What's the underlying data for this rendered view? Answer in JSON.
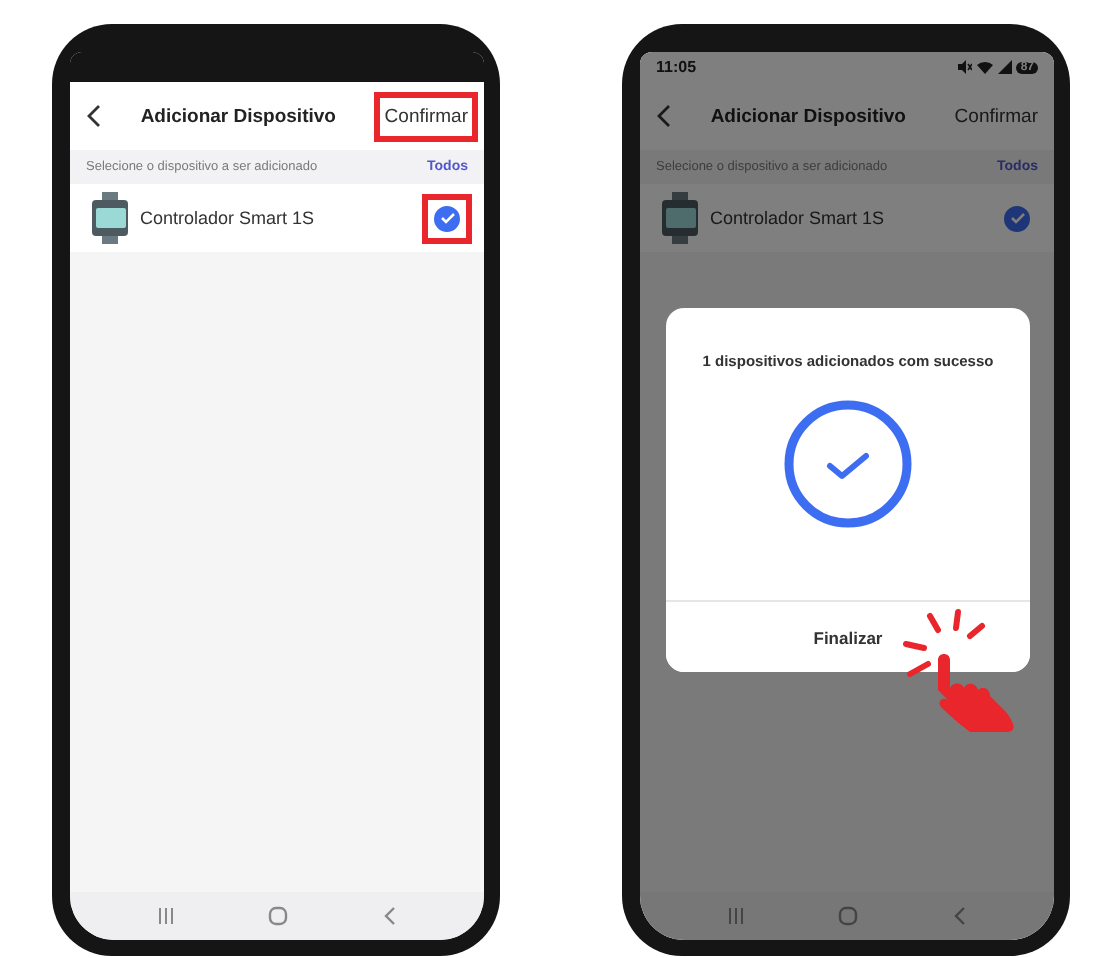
{
  "screens": [
    {
      "kind": "list",
      "header": {
        "title": "Adicionar Dispositivo",
        "action": "Confirmar",
        "action_highlighted": true
      },
      "hint": "Selecione o dispositivo a ser adicionado",
      "select_all": "Todos",
      "devices": [
        {
          "name": "Controlador Smart 1S",
          "checked": true,
          "highlighted": true
        }
      ]
    },
    {
      "kind": "dialog",
      "status_bar": {
        "time": "11:05",
        "battery": "87"
      },
      "header": {
        "title": "Adicionar Dispositivo",
        "action": "Confirmar",
        "action_highlighted": false
      },
      "hint": "Selecione o dispositivo a ser adicionado",
      "select_all": "Todos",
      "devices": [
        {
          "name": "Controlador Smart 1S",
          "checked": true,
          "highlighted": false
        }
      ],
      "dialog": {
        "message": "1 dispositivos adicionados com sucesso",
        "button": "Finalizar",
        "tap_hint": true
      }
    }
  ]
}
